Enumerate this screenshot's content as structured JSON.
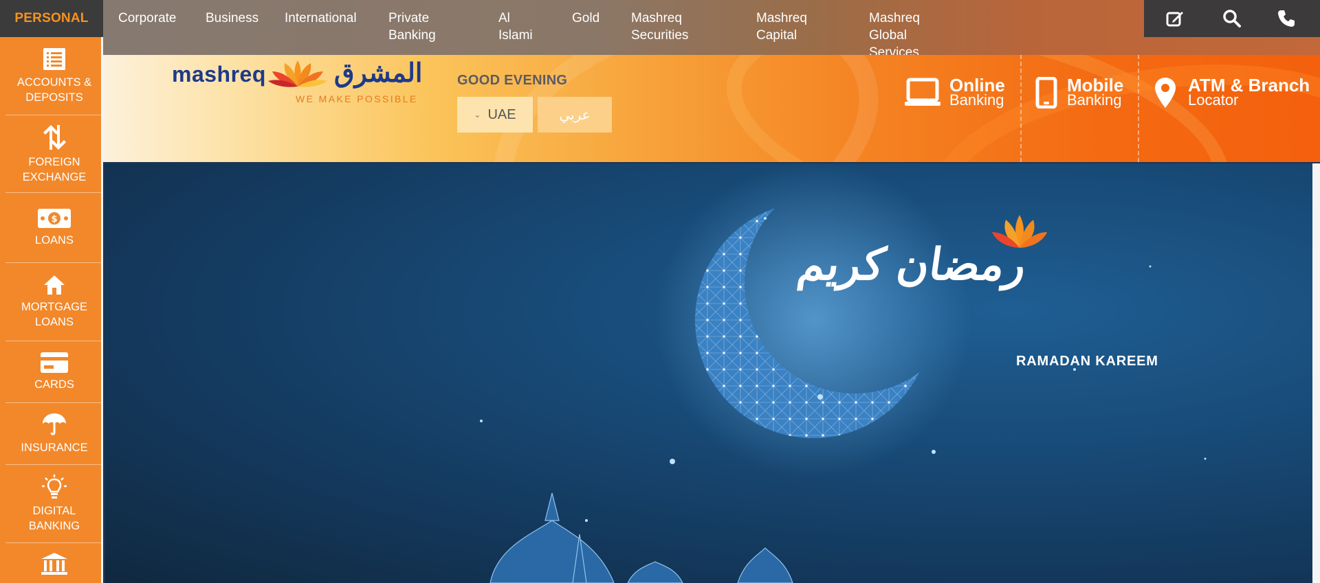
{
  "top_nav": {
    "personal_label": "PERSONAL",
    "items": [
      {
        "label": "Corporate"
      },
      {
        "label": "Business"
      },
      {
        "label": "International"
      },
      {
        "label": "Private\nBanking"
      },
      {
        "label": "Al\nIslami"
      },
      {
        "label": "Gold"
      },
      {
        "label": "Mashreq\nSecurities"
      },
      {
        "label": "Mashreq\nCapital"
      },
      {
        "label": "Mashreq Global\nServices"
      }
    ],
    "tools": [
      {
        "icon": "edit-icon"
      },
      {
        "icon": "search-icon"
      },
      {
        "icon": "phone-icon"
      }
    ]
  },
  "header": {
    "logo": {
      "en": "mashreq",
      "ar": "المشرق",
      "tagline": "WE MAKE POSSIBLE"
    },
    "greeting": "GOOD EVENING",
    "country_select": {
      "value": "UAE"
    },
    "language_button": "عربي",
    "quick_links": [
      {
        "line1": "Online",
        "line2": "Banking",
        "icon": "laptop-icon"
      },
      {
        "line1": "Mobile",
        "line2": "Banking",
        "icon": "mobile-icon"
      },
      {
        "line1": "ATM & Branch",
        "line2": "Locator",
        "icon": "location-pin-icon"
      }
    ]
  },
  "sidebar": {
    "items": [
      {
        "label": "ACCOUNTS &\nDEPOSITS",
        "icon": "accounts-list-icon"
      },
      {
        "label": "FOREIGN\nEXCHANGE",
        "icon": "exchange-arrows-icon"
      },
      {
        "label": "LOANS",
        "icon": "banknote-icon"
      },
      {
        "label": "MORTGAGE\nLOANS",
        "icon": "home-icon"
      },
      {
        "label": "CARDS",
        "icon": "credit-card-icon"
      },
      {
        "label": "INSURANCE",
        "icon": "umbrella-icon"
      },
      {
        "label": "DIGITAL\nBANKING",
        "icon": "lightbulb-icon"
      },
      {
        "label": "",
        "icon": "bank-building-icon"
      }
    ]
  },
  "hero": {
    "title_ar": "رمضان كريم",
    "subtitle": "RAMADAN KAREEM"
  },
  "colors": {
    "brand_orange": "#f2882a",
    "brand_blue": "#1d3a8a",
    "tab_dark": "#3b3b3b",
    "hero_blue": "#184b78"
  }
}
